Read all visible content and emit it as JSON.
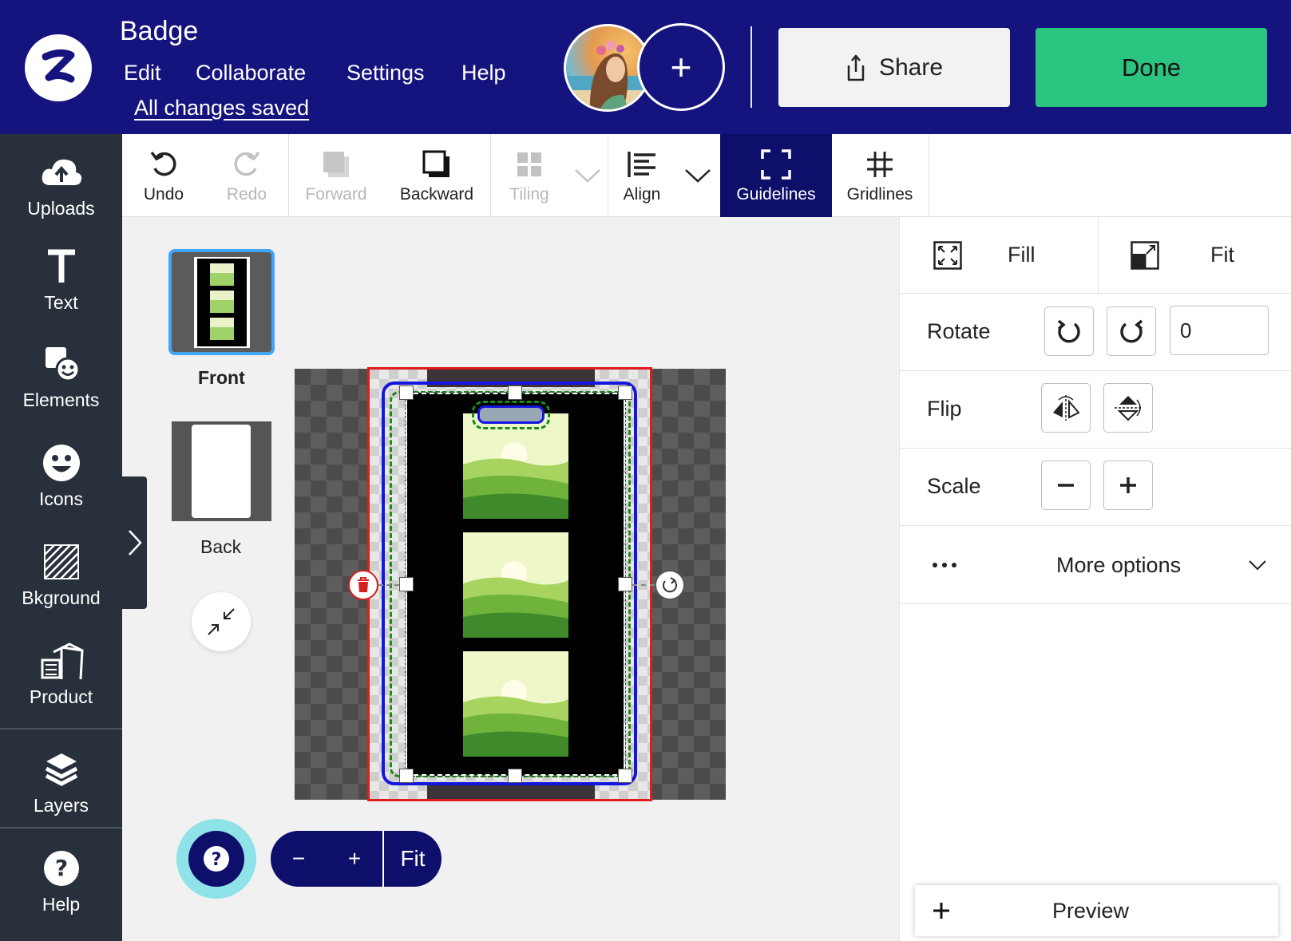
{
  "header": {
    "title": "Badge",
    "menu": [
      "Edit",
      "Collaborate",
      "Settings",
      "Help"
    ],
    "save_status": "All changes saved",
    "share_label": "Share",
    "done_label": "Done"
  },
  "sidebar": {
    "items": [
      {
        "label": "Uploads",
        "icon": "cloud-upload-icon"
      },
      {
        "label": "Text",
        "icon": "text-icon"
      },
      {
        "label": "Elements",
        "icon": "elements-icon"
      },
      {
        "label": "Icons",
        "icon": "smiley-icon"
      },
      {
        "label": "Bkground",
        "icon": "background-icon"
      },
      {
        "label": "Product",
        "icon": "product-icon"
      },
      {
        "label": "Layers",
        "icon": "layers-icon"
      },
      {
        "label": "Help",
        "icon": "help-icon"
      }
    ]
  },
  "toolbar": {
    "undo": "Undo",
    "redo": "Redo",
    "forward": "Forward",
    "backward": "Backward",
    "tiling": "Tiling",
    "align": "Align",
    "guidelines": "Guidelines",
    "gridlines": "Gridlines"
  },
  "pages": {
    "front": "Front",
    "back": "Back"
  },
  "panel": {
    "fill": "Fill",
    "fit": "Fit",
    "rotate_label": "Rotate",
    "rotate_value": "0",
    "flip_label": "Flip",
    "scale_label": "Scale",
    "more_options": "More options",
    "preview": "Preview"
  },
  "zoom": {
    "minus": "−",
    "plus": "+",
    "fit": "Fit"
  },
  "colors": {
    "header_bg": "#15137e",
    "done_green": "#2ac37f",
    "sidebar_bg": "#27303b",
    "active_tool": "#0e0f6b",
    "safe_area_red": "#e01c1c",
    "selection_blue": "#1515e0",
    "bleed_green": "#1a8a1a"
  }
}
